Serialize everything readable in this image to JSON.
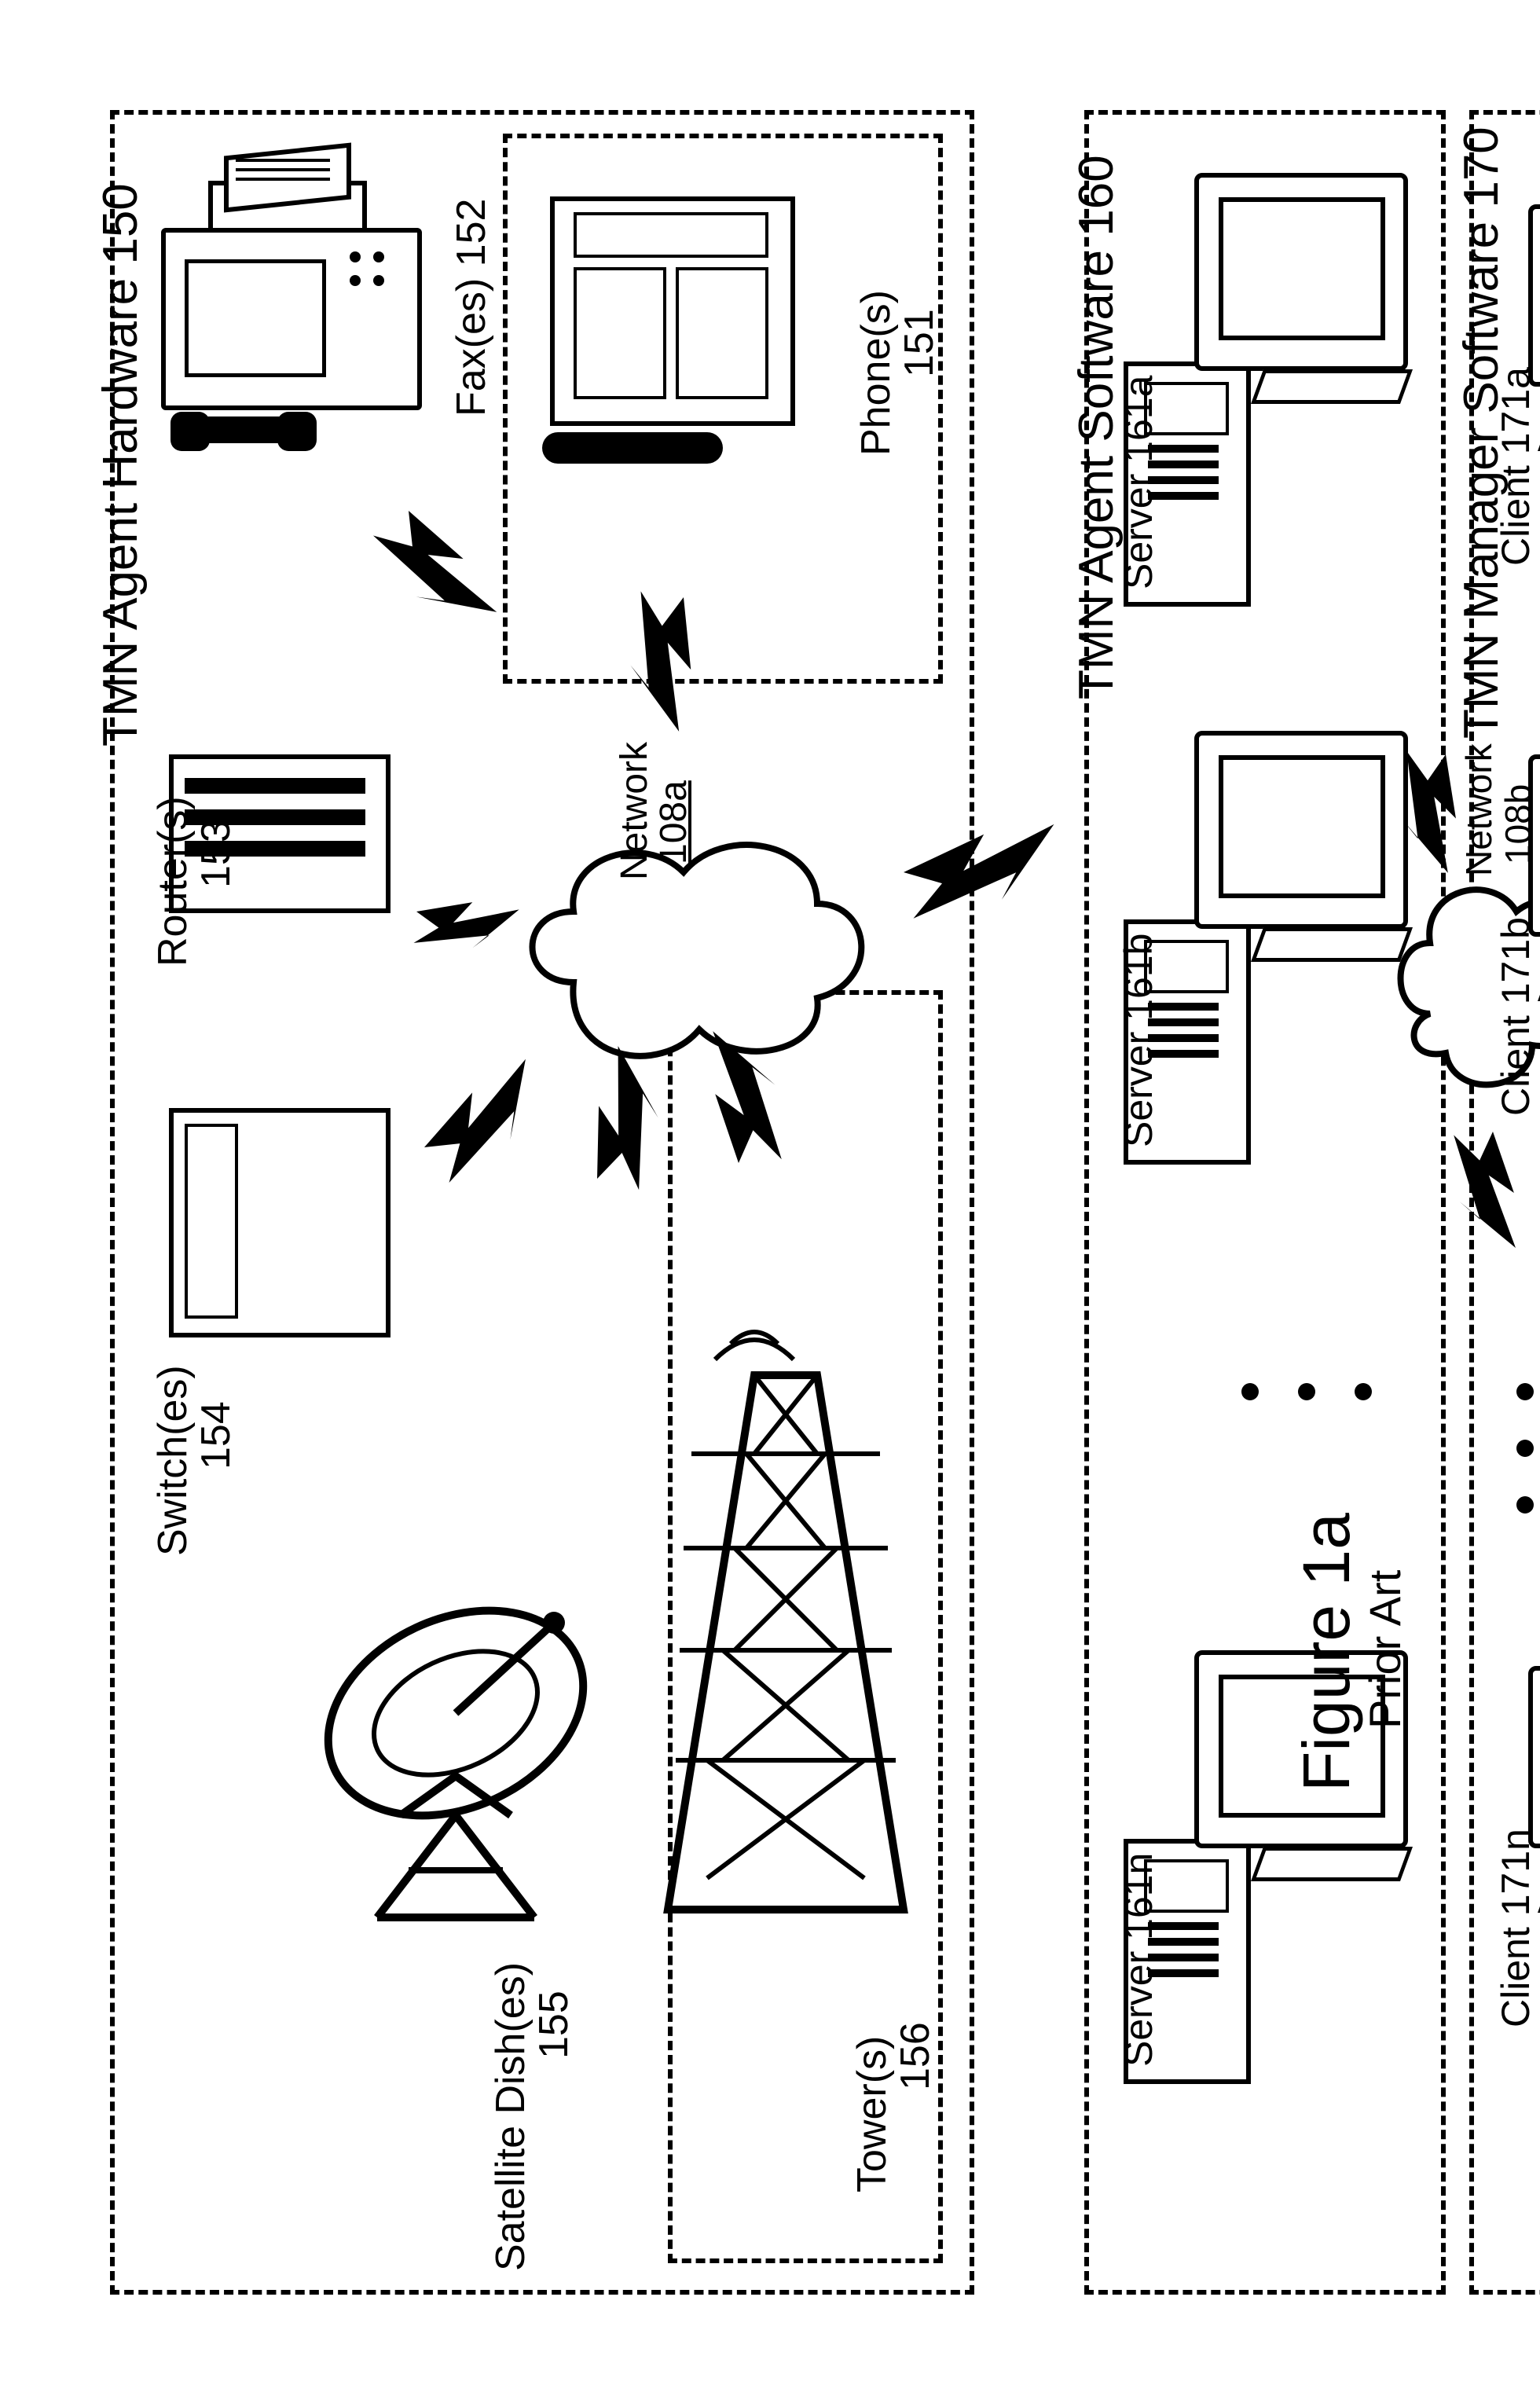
{
  "figure": {
    "title": "Figure 1a",
    "subtitle": "Prior Art"
  },
  "groups": {
    "hardware": {
      "title": "TMN Agent Hardware 150"
    },
    "agent_sw": {
      "title": "TMN Agent Software 160"
    },
    "manager_sw": {
      "title": "TMN Manager Software 170"
    }
  },
  "networks": {
    "a": {
      "label": "Network",
      "id": "108a"
    },
    "b": {
      "label": "Network",
      "id": "108b"
    }
  },
  "hardware_items": {
    "phones": {
      "label": "Phone(s)",
      "id": "151"
    },
    "faxes": {
      "label": "Fax(es) 152"
    },
    "routers": {
      "label": "Router(s)",
      "id": "153"
    },
    "switches": {
      "label": "Switch(es)",
      "id": "154"
    },
    "dishes": {
      "label": "Satellite Dish(es)",
      "id": "155"
    },
    "towers": {
      "label": "Tower(s)",
      "id": "156"
    }
  },
  "servers": [
    {
      "label": "Server 161a"
    },
    {
      "label": "Server 161b"
    },
    {
      "label": "Server 161n"
    }
  ],
  "clients": [
    {
      "label": "Client 171a"
    },
    {
      "label": "Client 171b"
    },
    {
      "label": "Client 171n"
    }
  ]
}
